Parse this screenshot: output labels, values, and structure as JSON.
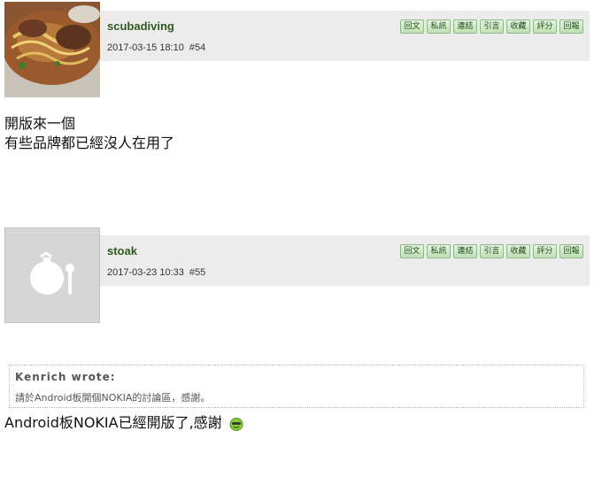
{
  "actions": [
    "回文",
    "私訊",
    "連結",
    "引言",
    "收藏",
    "評分",
    "回報"
  ],
  "posts": [
    {
      "username": "scubadiving",
      "datetime": "2017-03-15 18:10",
      "post_no": "#54",
      "body": [
        "開版來一個",
        "有些品牌都已經沒人在用了"
      ]
    },
    {
      "username": "stoak",
      "datetime": "2017-03-23 10:33",
      "post_no": "#55",
      "quote": {
        "author": "Kenrich wrote:",
        "text": "請於Android板開個NOKIA的討論區，感謝。"
      },
      "body": [
        "Android板NOKIA已經開版了,感謝"
      ],
      "emoticon": "smile-emoticon-icon"
    }
  ]
}
